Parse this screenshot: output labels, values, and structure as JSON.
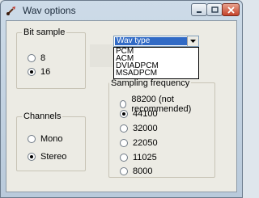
{
  "window": {
    "title": "Wav options"
  },
  "bit_sample": {
    "label": "Bit sample",
    "options": [
      {
        "label": "8",
        "selected": false
      },
      {
        "label": "16",
        "selected": true
      }
    ]
  },
  "channels": {
    "label": "Channels",
    "options": [
      {
        "label": "Mono",
        "selected": false
      },
      {
        "label": "Stereo",
        "selected": true
      }
    ]
  },
  "wav_type": {
    "selected": "Wav type",
    "options": [
      "PCM",
      "ACM",
      "DVIADPCM",
      "MSADPCM"
    ]
  },
  "sampling_frequency": {
    "label": "Sampling frequency",
    "options": [
      {
        "label": "88200 (not recommended)",
        "selected": false
      },
      {
        "label": "44100",
        "selected": true
      },
      {
        "label": "32000",
        "selected": false
      },
      {
        "label": "22050",
        "selected": false
      },
      {
        "label": "11025",
        "selected": false
      },
      {
        "label": "8000",
        "selected": false
      }
    ]
  }
}
